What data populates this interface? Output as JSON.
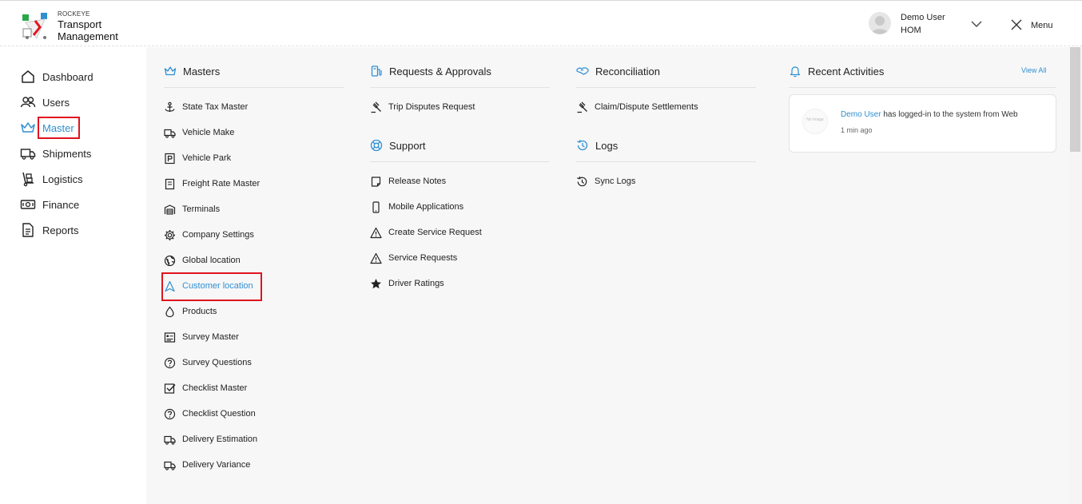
{
  "brand": {
    "small": "ROCKEYE",
    "line1": "Transport",
    "line2": "Management"
  },
  "user": {
    "name": "Demo User",
    "org": "HOM"
  },
  "header": {
    "menu_label": "Menu"
  },
  "sidebar": {
    "items": [
      {
        "label": "Dashboard",
        "icon": "home-icon"
      },
      {
        "label": "Users",
        "icon": "users-icon"
      },
      {
        "label": "Master",
        "icon": "crown-icon",
        "active": true
      },
      {
        "label": "Shipments",
        "icon": "truck-icon"
      },
      {
        "label": "Logistics",
        "icon": "dolly-icon"
      },
      {
        "label": "Finance",
        "icon": "money-icon"
      },
      {
        "label": "Reports",
        "icon": "document-icon"
      }
    ]
  },
  "sections": {
    "masters": {
      "title": "Masters",
      "items": [
        "State Tax Master",
        "Vehicle Make",
        "Vehicle Park",
        "Freight Rate Master",
        "Terminals",
        "Company Settings",
        "Global location",
        "Customer location",
        "Products",
        "Survey Master",
        "Survey Questions",
        "Checklist Master",
        "Checklist Question",
        "Delivery Estimation",
        "Delivery Variance"
      ],
      "active_item": "Customer location"
    },
    "requests": {
      "title": "Requests & Approvals",
      "items": [
        "Trip Disputes Request"
      ]
    },
    "support": {
      "title": "Support",
      "items": [
        "Release Notes",
        "Mobile Applications",
        "Create Service Request",
        "Service Requests",
        "Driver Ratings"
      ]
    },
    "reconciliation": {
      "title": "Reconciliation",
      "items": [
        "Claim/Dispute Settlements"
      ]
    },
    "logs": {
      "title": "Logs",
      "items": [
        "Sync Logs"
      ]
    },
    "recent": {
      "title": "Recent Activities",
      "view_all": "View All",
      "activity": {
        "no_image": "No Image",
        "user": "Demo User",
        "text": " has logged-in to the system from Web",
        "time": "1 min ago"
      }
    }
  },
  "colors": {
    "accent": "#2f8fd1",
    "highlight": "#e0141e",
    "panel_bg": "#f7f7f8"
  }
}
